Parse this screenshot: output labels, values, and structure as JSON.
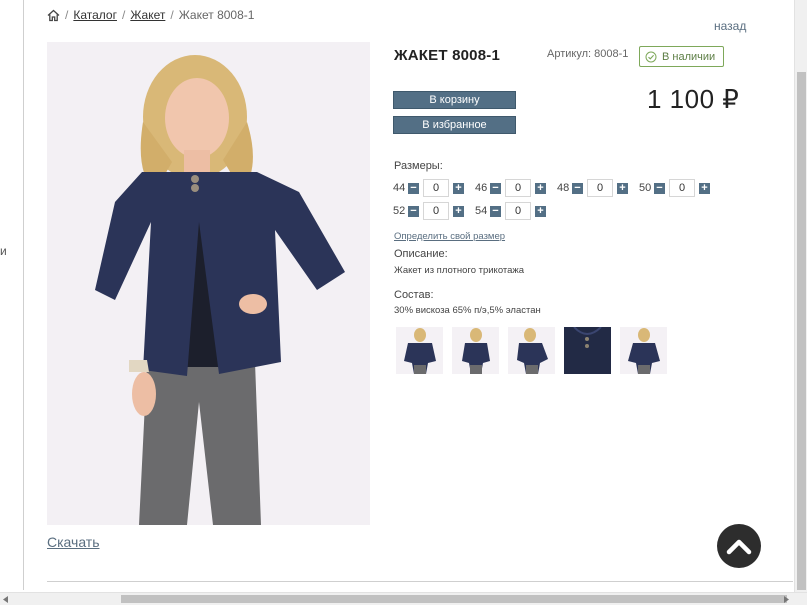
{
  "breadcrumb": {
    "home_icon": "home-icon",
    "separator": "/",
    "items": [
      {
        "label": "Каталог"
      },
      {
        "label": "Жакет"
      }
    ],
    "current": "Жакет 8008-1"
  },
  "back_label": "назад",
  "left_edge_char": "и",
  "product": {
    "title": "ЖАКЕТ 8008-1",
    "sku": "Артикул: 8008-1",
    "stock": "В наличии",
    "price": "1 100 ₽"
  },
  "buttons": {
    "cart": "В корзину",
    "favorites": "В избранное"
  },
  "sizes": {
    "label": "Размеры:",
    "rows": [
      [
        {
          "size": "44",
          "qty": "0"
        },
        {
          "size": "46",
          "qty": "0"
        },
        {
          "size": "48",
          "qty": "0"
        },
        {
          "size": "50",
          "qty": "0"
        }
      ],
      [
        {
          "size": "52",
          "qty": "0"
        },
        {
          "size": "54",
          "qty": "0"
        }
      ]
    ],
    "minus": "−",
    "plus": "+",
    "find_size_link": "Определить свой размер"
  },
  "description": {
    "label": "Описание:",
    "text": "Жакет из плотного трикотажа"
  },
  "composition": {
    "label": "Состав:",
    "text": "30% вискоза 65% п/э,5% эластан"
  },
  "download_label": "Скачать",
  "colors": {
    "accent": "#536f85",
    "jacket": "#2b3458",
    "stock_green": "#7ea85a"
  }
}
